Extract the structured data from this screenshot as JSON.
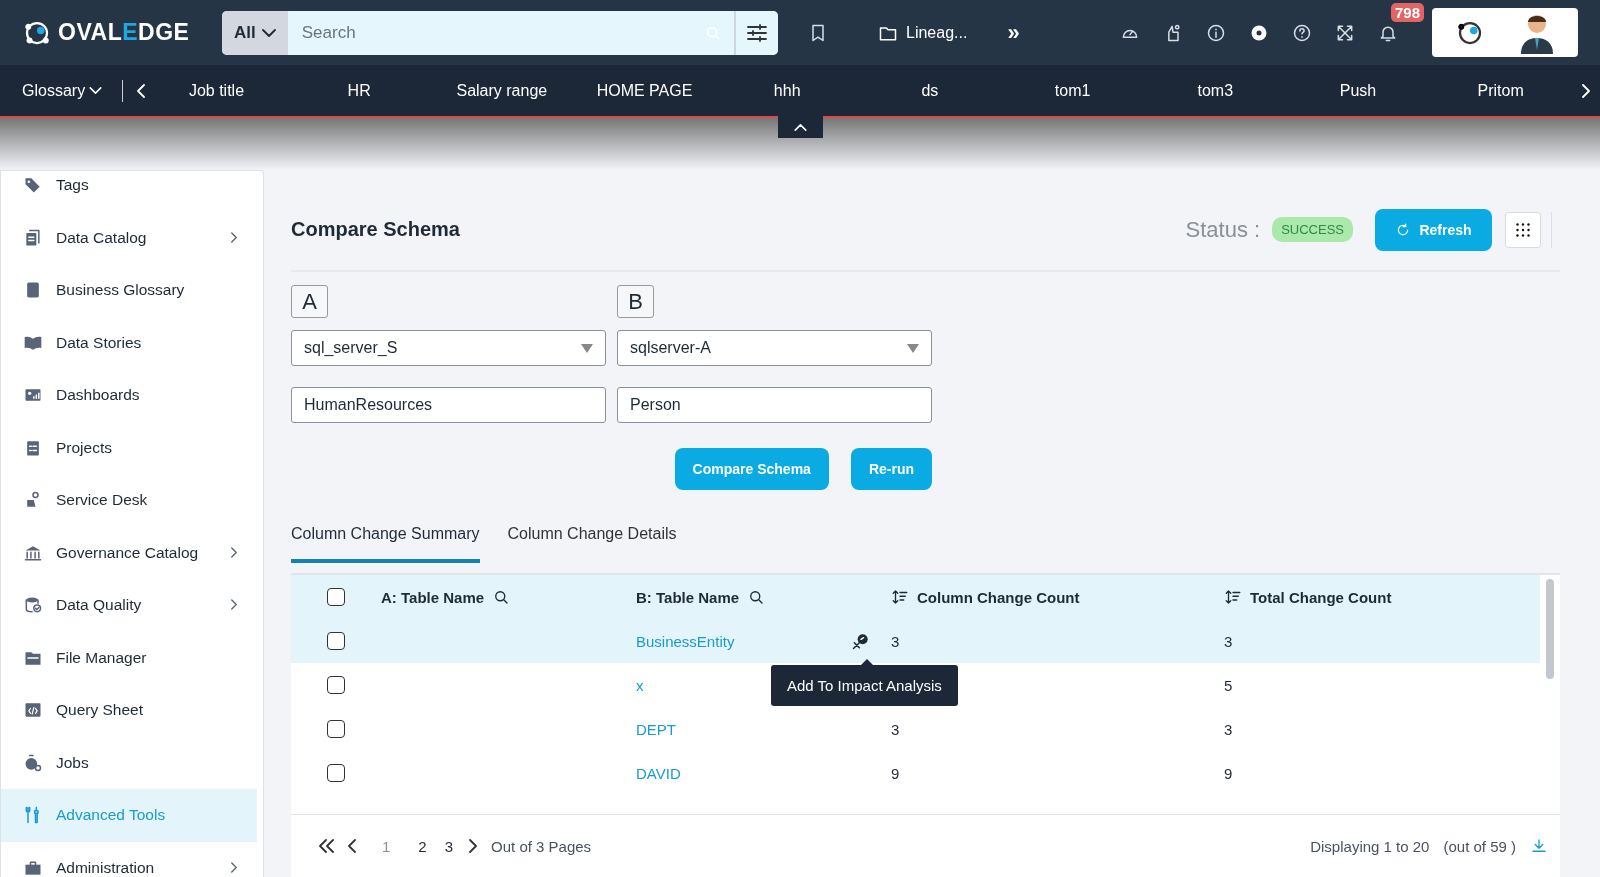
{
  "header": {
    "logo": [
      {
        "text": "OVAL",
        "accent": false
      },
      {
        "text": "E",
        "accent": true
      },
      {
        "text": "DGE",
        "accent": false
      }
    ],
    "search": {
      "scope": "All",
      "placeholder": "Search"
    },
    "breadcrumb": "Lineag...",
    "more": "»",
    "notification_count": "798"
  },
  "nav": {
    "menu": "Glossary",
    "items": [
      "Job title",
      "HR",
      "Salary range",
      "HOME PAGE",
      "hhh",
      "ds",
      "tom1",
      "tom3",
      "Push",
      "Pritom"
    ]
  },
  "sidebar": {
    "items": [
      {
        "label": "Tags",
        "submenu": false,
        "selected": false
      },
      {
        "label": "Data Catalog",
        "submenu": true,
        "selected": false
      },
      {
        "label": "Business Glossary",
        "submenu": false,
        "selected": false
      },
      {
        "label": "Data Stories",
        "submenu": false,
        "selected": false
      },
      {
        "label": "Dashboards",
        "submenu": false,
        "selected": false
      },
      {
        "label": "Projects",
        "submenu": false,
        "selected": false
      },
      {
        "label": "Service Desk",
        "submenu": false,
        "selected": false
      },
      {
        "label": "Governance Catalog",
        "submenu": true,
        "selected": false
      },
      {
        "label": "Data Quality",
        "submenu": true,
        "selected": false
      },
      {
        "label": "File Manager",
        "submenu": false,
        "selected": false
      },
      {
        "label": "Query Sheet",
        "submenu": false,
        "selected": false
      },
      {
        "label": "Jobs",
        "submenu": false,
        "selected": false
      },
      {
        "label": "Advanced Tools",
        "submenu": false,
        "selected": true
      },
      {
        "label": "Administration",
        "submenu": true,
        "selected": false
      }
    ]
  },
  "page": {
    "title": "Compare Schema",
    "status_label": "Status :",
    "status": "SUCCESS",
    "refresh": "Refresh",
    "sources": [
      {
        "label": "A",
        "connection": "sql_server_S",
        "schema": "HumanResources"
      },
      {
        "label": "B",
        "connection": "sqlserver-A",
        "schema": "Person"
      }
    ],
    "buttons": [
      "Compare Schema",
      "Re-run"
    ],
    "tabs": [
      {
        "label": "Column Change Summary",
        "selected": true
      },
      {
        "label": "Column Change Details",
        "selected": false
      }
    ],
    "table": {
      "all_checked": false,
      "columns": [
        "A: Table Name",
        "B: Table Name",
        "Column Change Count",
        "Total Change Count"
      ],
      "rows": [
        {
          "checked": false,
          "hovered": true,
          "b_table": "BusinessEntity",
          "column_change_count": "3",
          "total_change_count": "3"
        },
        {
          "checked": false,
          "hovered": false,
          "b_table": "x",
          "total_change_count": "5"
        },
        {
          "checked": false,
          "hovered": false,
          "b_table": "DEPT",
          "column_change_count": "3",
          "total_change_count": "3"
        },
        {
          "checked": false,
          "hovered": false,
          "b_table": "DAVID",
          "column_change_count": "9",
          "total_change_count": "9"
        }
      ],
      "tooltip": "Add To Impact Analysis"
    },
    "pager": {
      "pages": [
        {
          "label": "1",
          "selected": true
        },
        {
          "label": "2",
          "selected": false
        },
        {
          "label": "3",
          "selected": false
        }
      ],
      "total": "Out of 3 Pages",
      "displaying": "Displaying 1 to 20",
      "count": "(out of 59 )"
    }
  }
}
